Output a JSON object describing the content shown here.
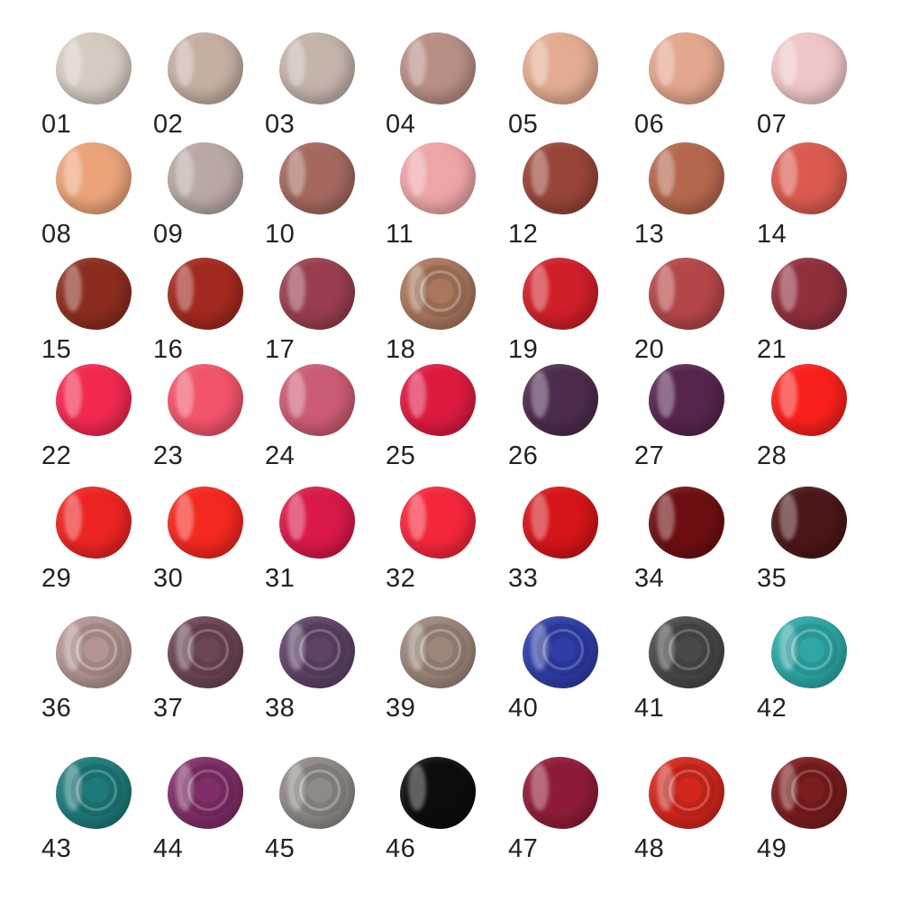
{
  "shades": [
    {
      "number": "01",
      "color": "#d6cbc1",
      "finish": "creme"
    },
    {
      "number": "02",
      "color": "#c5afa2",
      "finish": "creme"
    },
    {
      "number": "03",
      "color": "#c4b4aa",
      "finish": "creme"
    },
    {
      "number": "04",
      "color": "#b88f86",
      "finish": "creme"
    },
    {
      "number": "05",
      "color": "#e3ac92",
      "finish": "creme"
    },
    {
      "number": "06",
      "color": "#e3a68e",
      "finish": "creme"
    },
    {
      "number": "07",
      "color": "#efc6c7",
      "finish": "creme"
    },
    {
      "number": "08",
      "color": "#eba37a",
      "finish": "creme"
    },
    {
      "number": "09",
      "color": "#b9a9a4",
      "finish": "creme"
    },
    {
      "number": "10",
      "color": "#a4685f",
      "finish": "creme"
    },
    {
      "number": "11",
      "color": "#eea5a8",
      "finish": "creme"
    },
    {
      "number": "12",
      "color": "#974538",
      "finish": "creme"
    },
    {
      "number": "13",
      "color": "#b5674d",
      "finish": "creme"
    },
    {
      "number": "14",
      "color": "#da5a4f",
      "finish": "creme"
    },
    {
      "number": "15",
      "color": "#8b2d1e",
      "finish": "creme"
    },
    {
      "number": "16",
      "color": "#a2291f",
      "finish": "creme"
    },
    {
      "number": "17",
      "color": "#983e4e",
      "finish": "creme"
    },
    {
      "number": "18",
      "color": "#a9775e",
      "finish": "metallic"
    },
    {
      "number": "19",
      "color": "#cf1f29",
      "finish": "creme"
    },
    {
      "number": "20",
      "color": "#b44648",
      "finish": "creme"
    },
    {
      "number": "21",
      "color": "#8f2f3c",
      "finish": "creme"
    },
    {
      "number": "22",
      "color": "#f2284f",
      "finish": "creme"
    },
    {
      "number": "23",
      "color": "#f2546b",
      "finish": "creme"
    },
    {
      "number": "24",
      "color": "#cc5c73",
      "finish": "creme"
    },
    {
      "number": "25",
      "color": "#dd1a40",
      "finish": "creme"
    },
    {
      "number": "26",
      "color": "#4d2b4c",
      "finish": "creme"
    },
    {
      "number": "27",
      "color": "#57244d",
      "finish": "creme"
    },
    {
      "number": "28",
      "color": "#f9201c",
      "finish": "creme"
    },
    {
      "number": "29",
      "color": "#ec2422",
      "finish": "creme"
    },
    {
      "number": "30",
      "color": "#f3281e",
      "finish": "creme"
    },
    {
      "number": "31",
      "color": "#d91948",
      "finish": "creme"
    },
    {
      "number": "32",
      "color": "#f4263a",
      "finish": "creme"
    },
    {
      "number": "33",
      "color": "#d41419",
      "finish": "creme"
    },
    {
      "number": "34",
      "color": "#6d0f12",
      "finish": "creme"
    },
    {
      "number": "35",
      "color": "#4b1616",
      "finish": "creme"
    },
    {
      "number": "36",
      "color": "#b39592",
      "finish": "metallic"
    },
    {
      "number": "37",
      "color": "#6d4558",
      "finish": "metallic"
    },
    {
      "number": "38",
      "color": "#5e4367",
      "finish": "metallic"
    },
    {
      "number": "39",
      "color": "#9d877a",
      "finish": "metallic"
    },
    {
      "number": "40",
      "color": "#2f3da6",
      "finish": "metallic"
    },
    {
      "number": "41",
      "color": "#4a4848",
      "finish": "metallic"
    },
    {
      "number": "42",
      "color": "#2ea8a6",
      "finish": "metallic"
    },
    {
      "number": "43",
      "color": "#1e7a7a",
      "finish": "metallic"
    },
    {
      "number": "44",
      "color": "#7f2e67",
      "finish": "metallic"
    },
    {
      "number": "45",
      "color": "#8f8a87",
      "finish": "metallic"
    },
    {
      "number": "46",
      "color": "#0c0c0e",
      "finish": "creme"
    },
    {
      "number": "47",
      "color": "#8e1c38",
      "finish": "creme"
    },
    {
      "number": "48",
      "color": "#d2271d",
      "finish": "metallic"
    },
    {
      "number": "49",
      "color": "#7b1c1e",
      "finish": "metallic"
    }
  ]
}
